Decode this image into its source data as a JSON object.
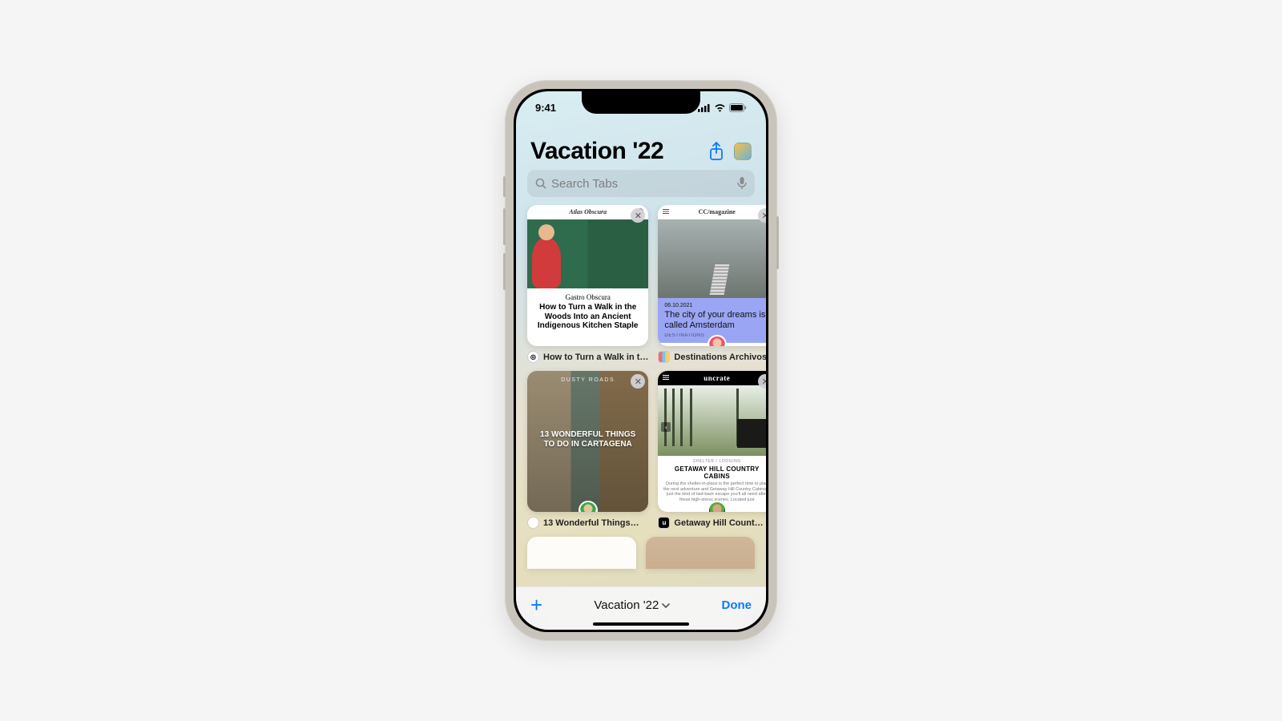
{
  "status": {
    "time": "9:41"
  },
  "header": {
    "title": "Vacation '22"
  },
  "search": {
    "placeholder": "Search Tabs"
  },
  "tabs": [
    {
      "mini_header": "Atlas Obscura",
      "kicker": "Gastro Obscura",
      "headline": "How to Turn a Walk in the Woods Into an Ancient Indigenous Kitchen Staple",
      "caption": "How to Turn a Walk in t…"
    },
    {
      "mini_header": "CC/magazine",
      "date": "06.10.2021",
      "headline": "The city of your dreams is called Amsterdam",
      "category": "DESTINATIONS",
      "caption": "Destinations Archivos…"
    },
    {
      "kicker": "DUSTY ROADS",
      "headline": "13 WONDERFUL THINGS TO DO IN CARTAGENA",
      "caption": "13 Wonderful Things…"
    },
    {
      "mini_header": "uncrate",
      "category": "SHELTER / LODGING",
      "headline": "GETAWAY HILL COUNTRY CABINS",
      "blurb": "During the shelter-in-place is the perfect time to plan the next adventure and Getaway Hill Country Cabins is just the kind of laid-back escape you'll all need after these high-stress scenes. Located just",
      "caption": "Getaway Hill Count…"
    }
  ],
  "bottom": {
    "group_label": "Vacation '22",
    "done": "Done"
  }
}
